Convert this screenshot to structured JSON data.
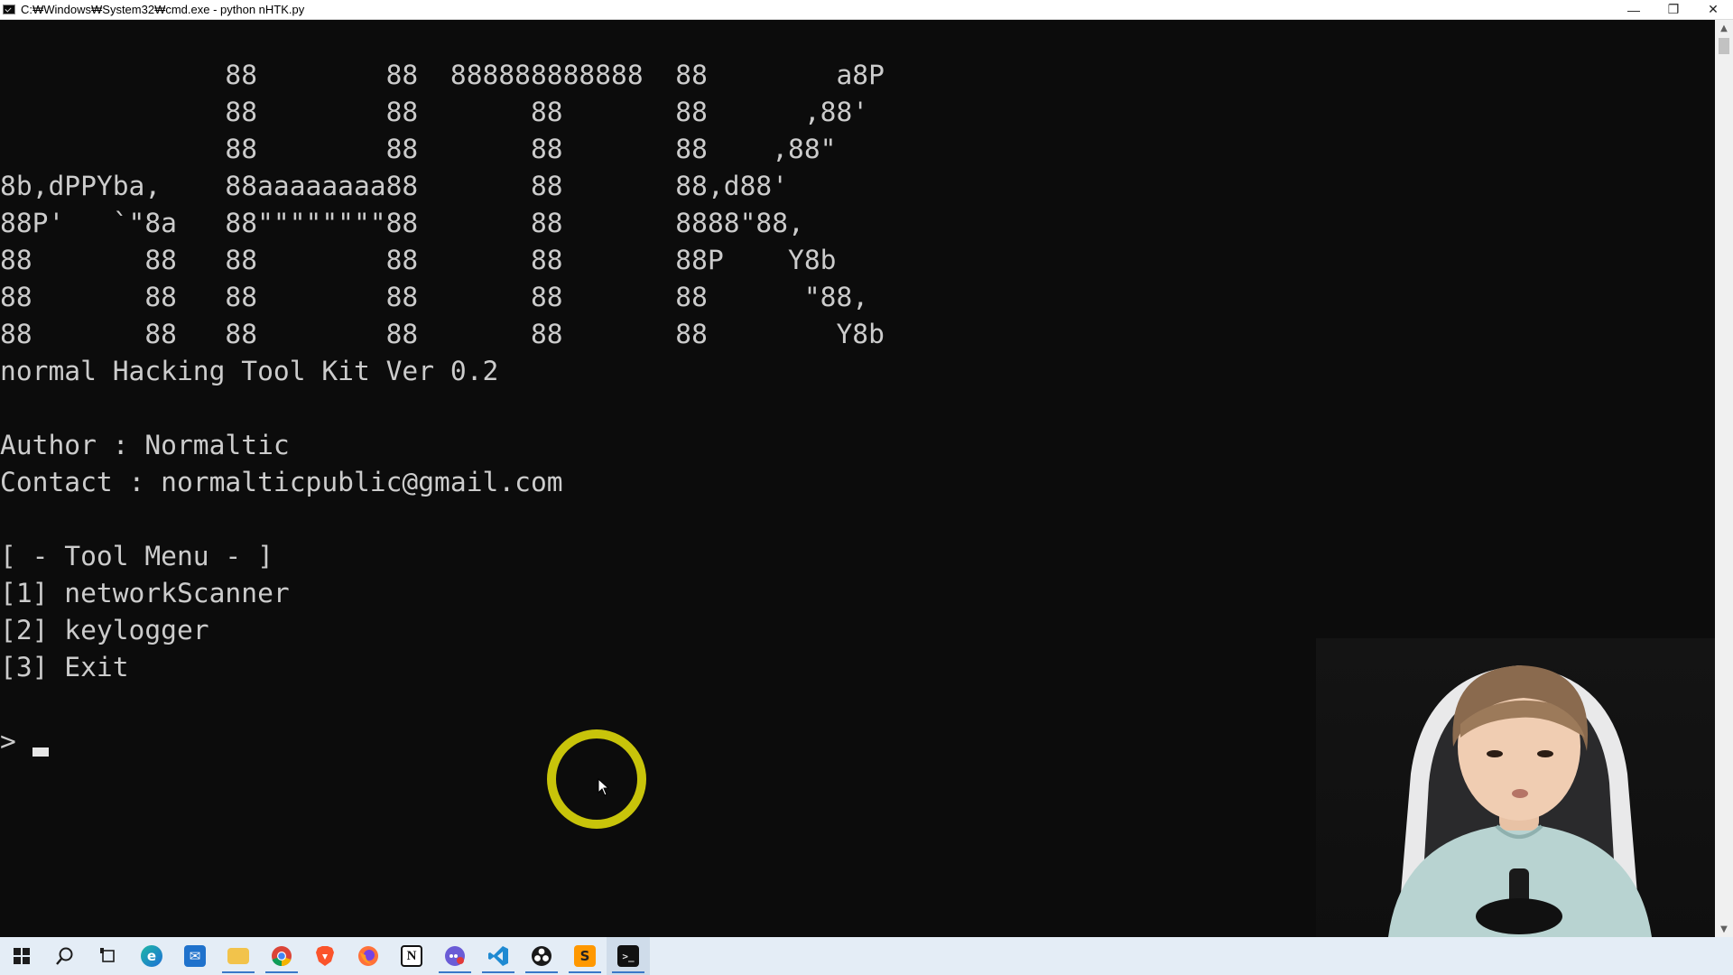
{
  "window": {
    "title": "C:₩Windows₩System32₩cmd.exe - python  nHTK.py",
    "controls": {
      "minimize": "—",
      "restore": "❐",
      "close": "✕"
    }
  },
  "terminal": {
    "banner_lines": [
      "              88        88  888888888888  88        a8P",
      "              88        88       88       88      ,88'",
      "              88        88       88       88    ,88\"",
      "8b,dPPYba,    88aaaaaaaa88       88       88,d88'",
      "88P'   `\"8a   88\"\"\"\"\"\"\"\"88       88       8888\"88,",
      "88       88   88        88       88       88P    Y8b",
      "88       88   88        88       88       88      \"88,",
      "88       88   88        88       88       88        Y8b"
    ],
    "tool_name": "normal Hacking Tool Kit Ver 0.2",
    "author_line": "Author : Normaltic",
    "contact_line": "Contact : normalticpublic@gmail.com",
    "menu_title": "[ - Tool Menu - ]",
    "menu_items": [
      "[1] networkScanner",
      "[2] keylogger",
      "[3] Exit"
    ],
    "prompt_symbol": ">"
  },
  "colors": {
    "terminal_bg": "#0c0c0c",
    "terminal_fg": "#cccccc",
    "highlight_ring": "#c8c40a",
    "taskbar_bg": "#e4edf6"
  },
  "webcam": {
    "description_icon": "webcam-overlay"
  },
  "taskbar": {
    "items": [
      {
        "name": "start-button",
        "icon": "windows-icon",
        "glyph": "⊞"
      },
      {
        "name": "search-button",
        "icon": "search-icon",
        "glyph": "⚲"
      },
      {
        "name": "task-view-button",
        "icon": "task-view-icon",
        "glyph": "▣"
      },
      {
        "name": "edge-button",
        "icon": "edge-icon",
        "glyph": "e"
      },
      {
        "name": "mail-button",
        "icon": "mail-icon",
        "glyph": "✉"
      },
      {
        "name": "file-explorer-button",
        "icon": "folder-icon",
        "glyph": "▬"
      },
      {
        "name": "chrome-button",
        "icon": "chrome-icon",
        "glyph": "◉"
      },
      {
        "name": "brave-button",
        "icon": "brave-icon",
        "glyph": "▼"
      },
      {
        "name": "firefox-button",
        "icon": "firefox-icon",
        "glyph": "●"
      },
      {
        "name": "notion-button",
        "icon": "notion-icon",
        "glyph": "N"
      },
      {
        "name": "chat-app-button",
        "icon": "chat-icon",
        "glyph": "●"
      },
      {
        "name": "vscode-button",
        "icon": "vscode-icon",
        "glyph": "❮"
      },
      {
        "name": "obs-button",
        "icon": "obs-icon",
        "glyph": "●"
      },
      {
        "name": "sublime-button",
        "icon": "sublime-text-icon",
        "glyph": "S"
      },
      {
        "name": "terminal-button",
        "icon": "cmd-icon",
        "glyph": ">_"
      }
    ]
  }
}
